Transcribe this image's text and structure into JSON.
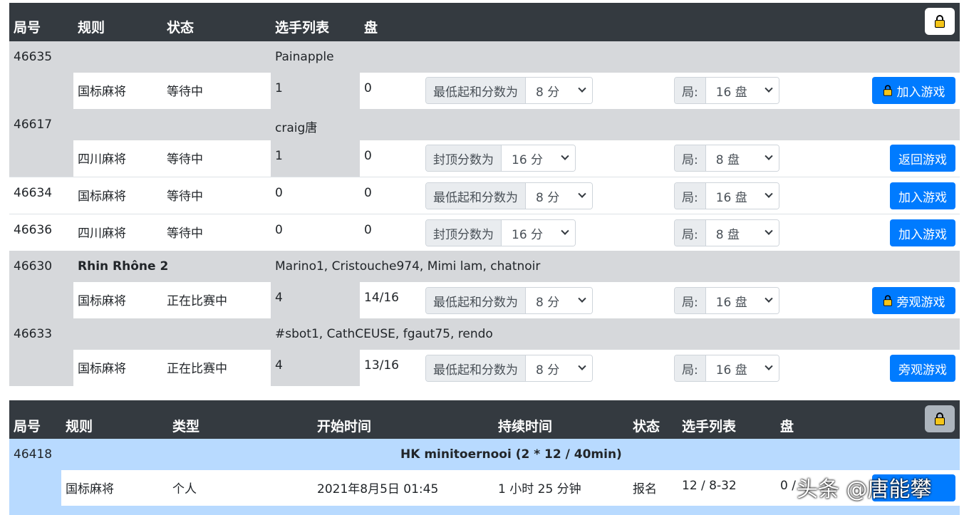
{
  "games_header": {
    "id": "局号",
    "rule": "规则",
    "status": "状态",
    "players": "选手列表",
    "rounds": "盘"
  },
  "games": [
    {
      "id": "46635",
      "name": "",
      "players": "Painapple",
      "rule": "国标麻将",
      "status": "等待中",
      "player_count": "1",
      "rounds_played": "0",
      "score_label": "最低起和分数为",
      "score_value": "8 分",
      "round_label": "局:",
      "round_value": "16 盘",
      "action": "加入游戏",
      "locked": true
    },
    {
      "id": "46617",
      "name": "",
      "players": "craig唐",
      "rule": "四川麻将",
      "status": "等待中",
      "player_count": "1",
      "rounds_played": "0",
      "score_label": "封顶分数为",
      "score_value": "16 分",
      "round_label": "局:",
      "round_value": "8 盘",
      "action": "返回游戏",
      "locked": false
    },
    {
      "id": "46634",
      "rule": "国标麻将",
      "status": "等待中",
      "player_count": "0",
      "rounds_played": "0",
      "score_label": "最低起和分数为",
      "score_value": "8 分",
      "round_label": "局:",
      "round_value": "16 盘",
      "action": "加入游戏",
      "locked": false
    },
    {
      "id": "46636",
      "rule": "四川麻将",
      "status": "等待中",
      "player_count": "0",
      "rounds_played": "0",
      "score_label": "封顶分数为",
      "score_value": "16 分",
      "round_label": "局:",
      "round_value": "8 盘",
      "action": "加入游戏",
      "locked": false
    },
    {
      "id": "46630",
      "name": "Rhin Rhône 2",
      "players": "Marino1, Cristouche974, Mimi lam, chatnoir",
      "rule": "国标麻将",
      "status": "正在比赛中",
      "player_count": "4",
      "rounds_played": "14/16",
      "score_label": "最低起和分数为",
      "score_value": "8 分",
      "round_label": "局:",
      "round_value": "16 盘",
      "action": "旁观游戏",
      "locked": true
    },
    {
      "id": "46633",
      "name": "",
      "players": "#sbot1, CathCEUSE, fgaut75, rendo",
      "rule": "国标麻将",
      "status": "正在比赛中",
      "player_count": "4",
      "rounds_played": "13/16",
      "score_label": "最低起和分数为",
      "score_value": "8 分",
      "round_label": "局:",
      "round_value": "16 盘",
      "action": "旁观游戏",
      "locked": false
    }
  ],
  "tournaments_header": {
    "id": "局号",
    "rule": "规则",
    "type": "类型",
    "start": "开始时间",
    "duration": "持续时间",
    "status": "状态",
    "players": "选手列表",
    "rounds": "盘"
  },
  "tournament": {
    "id": "46418",
    "name": "HK minitoernooi (2 * 12 / 40min)",
    "rule": "国标麻将",
    "type": "个人",
    "start": "2021年8月5日 01:45",
    "duration": "1 小时 25 分钟",
    "status": "报名",
    "players": "12 / 8-32",
    "rounds": "0 /"
  },
  "watermark": "头条 @唐能攀",
  "colors": {
    "header_bg": "#343a40",
    "row_grey": "#d6d8db",
    "button_blue": "#007bff",
    "tournament_blue": "#b8daff"
  }
}
